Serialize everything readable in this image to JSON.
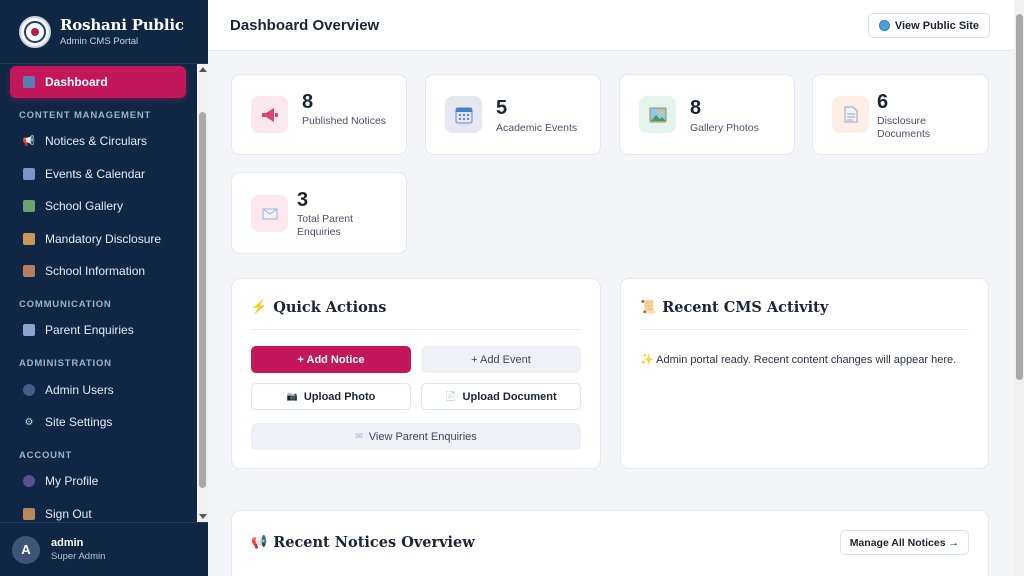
{
  "brand": {
    "title": "Roshani Public",
    "subtitle": "Admin CMS Portal"
  },
  "sidebar": {
    "dashboard": "Dashboard",
    "sections": {
      "content": "CONTENT MANAGEMENT",
      "communication": "COMMUNICATION",
      "administration": "ADMINISTRATION",
      "account": "ACCOUNT"
    },
    "items": {
      "notices": "Notices & Circulars",
      "events": "Events & Calendar",
      "gallery": "School Gallery",
      "disclosure": "Mandatory Disclosure",
      "info": "School Information",
      "enquiries": "Parent Enquiries",
      "admin_users": "Admin Users",
      "settings": "Site Settings",
      "profile": "My Profile",
      "signout": "Sign Out"
    }
  },
  "user": {
    "initial": "A",
    "name": "admin",
    "role": "Super Admin"
  },
  "header": {
    "title": "Dashboard Overview",
    "public_site": "View Public Site"
  },
  "stats": [
    {
      "value": "8",
      "label": "Published Notices"
    },
    {
      "value": "5",
      "label": "Academic Events"
    },
    {
      "value": "8",
      "label": "Gallery Photos"
    },
    {
      "value": "6",
      "label": "Disclosure Documents"
    },
    {
      "value": "3",
      "label": "Total Parent Enquiries"
    }
  ],
  "quick_actions": {
    "title": "Quick Actions",
    "add_notice": "+ Add Notice",
    "add_event": "+ Add Event",
    "upload_photo": "Upload Photo",
    "upload_document": "Upload Document",
    "view_enquiries": "View Parent Enquiries"
  },
  "activity": {
    "title": "Recent CMS Activity",
    "message": "Admin portal ready. Recent content changes will appear here."
  },
  "notices_overview": {
    "title": "Recent Notices Overview",
    "manage": "Manage All Notices →"
  },
  "colors": {
    "sidebar": "#0f2744",
    "accent": "#c2185b"
  }
}
